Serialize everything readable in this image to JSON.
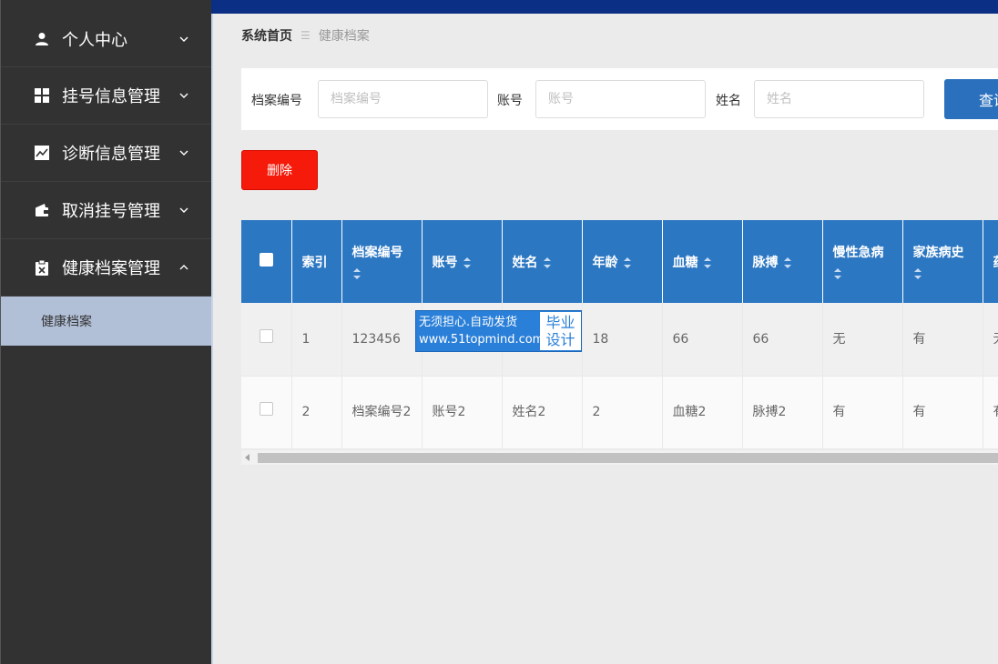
{
  "sidebar": {
    "items": [
      {
        "label": "个人中心",
        "icon": "user-icon"
      },
      {
        "label": "挂号信息管理",
        "icon": "grid-icon"
      },
      {
        "label": "诊断信息管理",
        "icon": "chart-icon"
      },
      {
        "label": "取消挂号管理",
        "icon": "wallet-icon"
      },
      {
        "label": "健康档案管理",
        "icon": "clipboard-icon"
      }
    ],
    "submenu": {
      "label": "健康档案"
    }
  },
  "breadcrumb": {
    "home": "系统首页",
    "separator": "☰",
    "current": "健康档案"
  },
  "search": {
    "fields": [
      {
        "label": "档案编号",
        "placeholder": "档案编号",
        "value": ""
      },
      {
        "label": "账号",
        "placeholder": "账号",
        "value": ""
      },
      {
        "label": "姓名",
        "placeholder": "姓名",
        "value": ""
      }
    ],
    "button_label": "查询"
  },
  "actions": {
    "delete_label": "删除"
  },
  "table": {
    "columns": [
      "索引",
      "档案编号",
      "账号",
      "姓名",
      "年龄",
      "血糖",
      "脉搏",
      "慢性急病",
      "家族病史",
      "药物"
    ],
    "rows": [
      [
        "1",
        "123456",
        "",
        "",
        "18",
        "66",
        "66",
        "无",
        "有",
        "无"
      ],
      [
        "2",
        "档案编号2",
        "账号2",
        "姓名2",
        "2",
        "血糖2",
        "脉搏2",
        "有",
        "有",
        "有"
      ]
    ]
  },
  "watermark": {
    "line1": "无须担心.自动发货",
    "line2": "www.51topmind.com",
    "badge1": "毕业",
    "badge2": "设计"
  },
  "colors": {
    "sidebar_bg": "#323232",
    "topbar": "#0b2f84",
    "table_header": "#2c77c2",
    "delete_button": "#f51a0a",
    "search_button": "#2a70bd",
    "submenu_active": "#b1bfd7"
  }
}
